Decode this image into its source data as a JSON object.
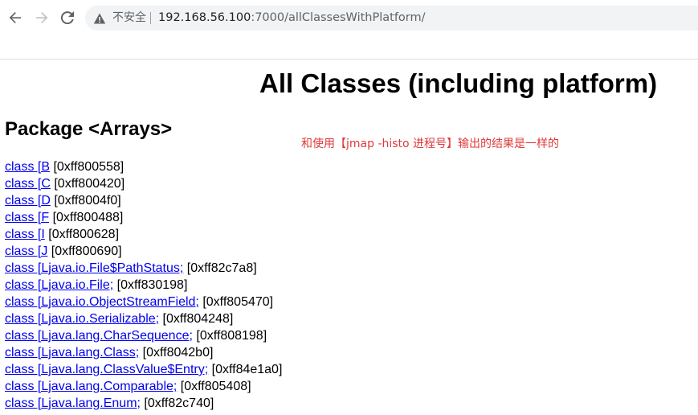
{
  "browser": {
    "back_icon": "arrow-left-icon",
    "forward_icon": "arrow-right-icon",
    "reload_icon": "reload-icon",
    "security_icon": "warning-triangle-icon",
    "security_label": "不安全",
    "url_host": "192.168.56.100",
    "url_rest": ":7000/allClassesWithPlatform/"
  },
  "page": {
    "title": "All Classes (including platform)",
    "package_heading": "Package <Arrays>",
    "annotation": "和使用【jmap -histo 进程号】输出的结果是一样的",
    "annotation_color": "#e03a3a",
    "link_color": "#0000ee"
  },
  "classes": [
    {
      "link": "class [B",
      "addr": " [0xff800558]"
    },
    {
      "link": "class [C",
      "addr": " [0xff800420]"
    },
    {
      "link": "class [D",
      "addr": " [0xff8004f0]"
    },
    {
      "link": "class [F",
      "addr": " [0xff800488]"
    },
    {
      "link": "class [I",
      "addr": " [0xff800628]"
    },
    {
      "link": "class [J",
      "addr": " [0xff800690]"
    },
    {
      "link": "class [Ljava.io.File$PathStatus;",
      "addr": " [0xff82c7a8]"
    },
    {
      "link": "class [Ljava.io.File;",
      "addr": " [0xff830198]"
    },
    {
      "link": "class [Ljava.io.ObjectStreamField;",
      "addr": " [0xff805470]"
    },
    {
      "link": "class [Ljava.io.Serializable;",
      "addr": " [0xff804248]"
    },
    {
      "link": "class [Ljava.lang.CharSequence;",
      "addr": " [0xff808198]"
    },
    {
      "link": "class [Ljava.lang.Class;",
      "addr": " [0xff8042b0]"
    },
    {
      "link": "class [Ljava.lang.ClassValue$Entry;",
      "addr": " [0xff84e1a0]"
    },
    {
      "link": "class [Ljava.lang.Comparable;",
      "addr": " [0xff805408]"
    },
    {
      "link": "class [Ljava.lang.Enum;",
      "addr": " [0xff82c740]"
    }
  ]
}
